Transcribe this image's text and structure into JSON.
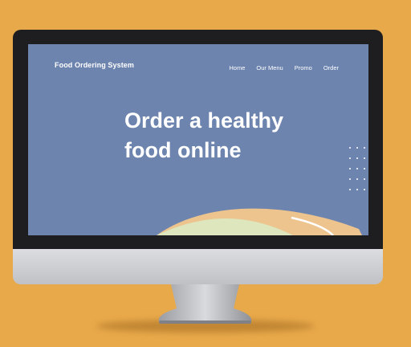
{
  "brand": {
    "title": "Food Ordering System"
  },
  "nav": {
    "items": [
      "Home",
      "Our Menu",
      "Promo",
      "Order"
    ]
  },
  "hero": {
    "line1": "Order a healthy",
    "line2": "food online"
  },
  "colors": {
    "background": "#E8A94A",
    "screen": "#6D84AF",
    "bezel": "#1E1E20",
    "hill_orange": "#EDC48E",
    "hill_green": "#DDE6BD",
    "accent_white": "#FFFFFF"
  }
}
